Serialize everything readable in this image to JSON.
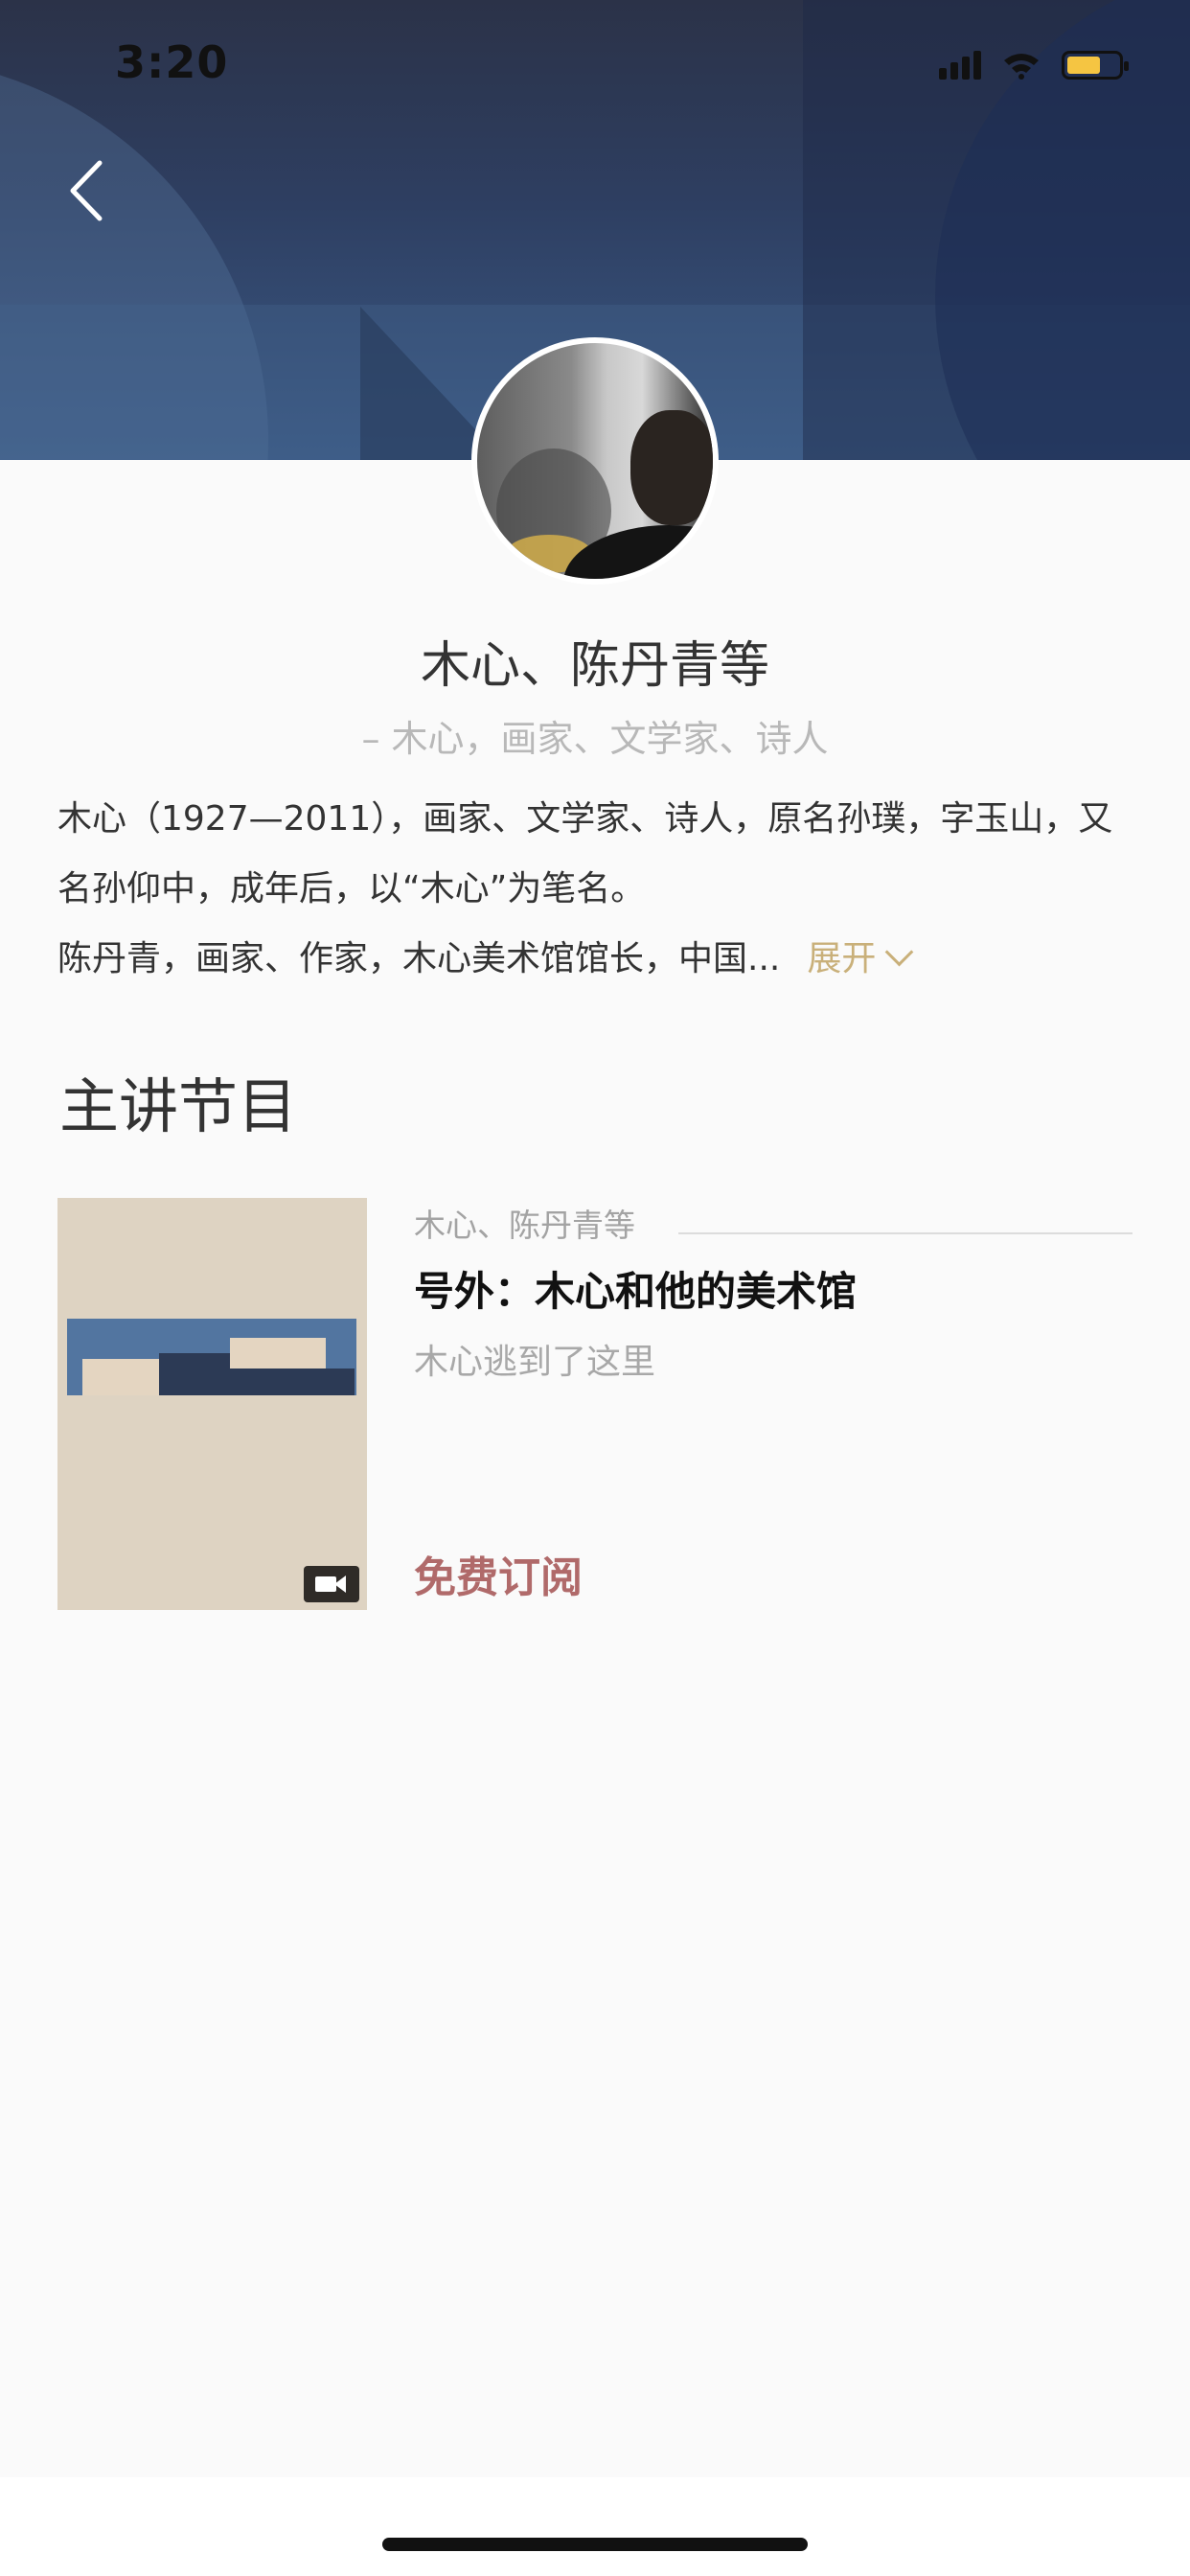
{
  "status_bar": {
    "time": "3:20"
  },
  "profile": {
    "name": "木心、陈丹青等",
    "subtitle": "– 木心，画家、文学家、诗人",
    "bio_line1": "木心（1927—2011），画家、文学家、诗人，原名孙璞，字玉山，又名孙仰中，成年后，以“木心”为笔名。",
    "bio_line2": "陈丹青，画家、作家，木心美术馆馆长，中国...",
    "expand_label": "展开"
  },
  "section": {
    "title": "主讲节目"
  },
  "course": {
    "author": "木心、陈丹青等",
    "title": "号外：木心和他的美术馆",
    "description": "木心逃到了这里",
    "action": "免费订阅"
  },
  "colors": {
    "header_top": "#2b3248",
    "accent_gold": "#c9b07a",
    "action_red": "#b06a6a",
    "battery_yellow": "#f5c542"
  },
  "icons": [
    "back-chevron-icon",
    "signal-icon",
    "wifi-icon",
    "battery-icon",
    "chevron-down-icon",
    "video-icon"
  ]
}
